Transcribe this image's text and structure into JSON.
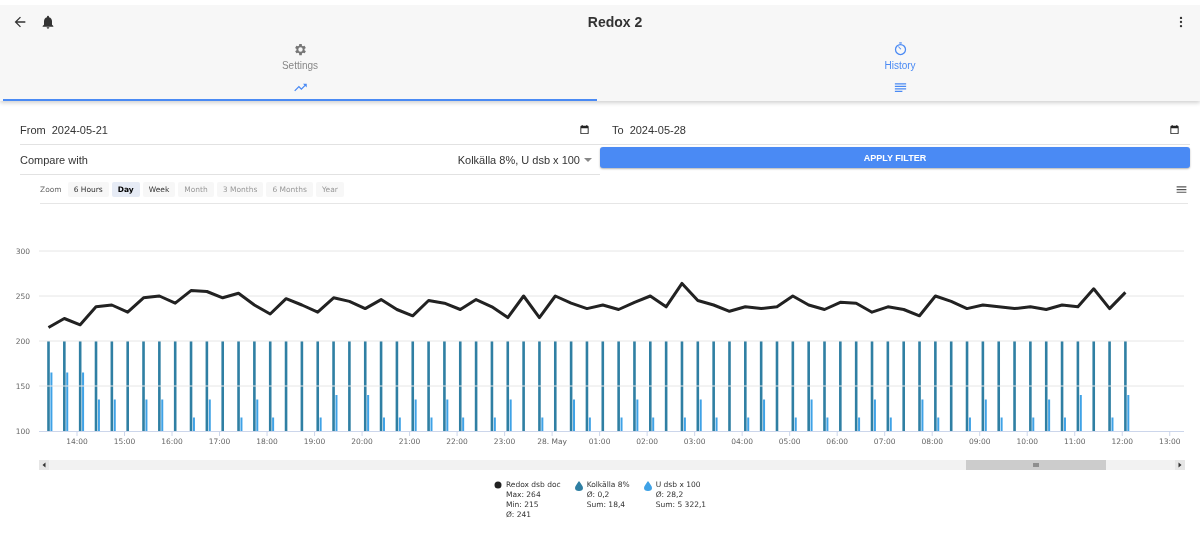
{
  "header": {
    "title": "Redox 2"
  },
  "tabs": [
    {
      "label": "Settings",
      "kind": "gear",
      "selected": false
    },
    {
      "label": "History",
      "kind": "timer",
      "selected": true
    }
  ],
  "sub_tabs": [
    {
      "kind": "chart",
      "selected": true
    },
    {
      "kind": "list",
      "selected": false
    }
  ],
  "filter": {
    "from": {
      "label": "From",
      "value": "2024-05-21"
    },
    "to": {
      "label": "To",
      "value": "2024-05-28"
    },
    "compare": {
      "label": "Compare with",
      "value": "Kolkälla 8%, U dsb x 100"
    },
    "apply_button": "APPLY FILTER"
  },
  "chart": {
    "zoom_label": "Zoom",
    "zoom_buttons": [
      {
        "label": "6 Hours",
        "selected": false,
        "disabled": false
      },
      {
        "label": "Day",
        "selected": true,
        "disabled": false
      },
      {
        "label": "Week",
        "selected": false,
        "disabled": false
      },
      {
        "label": "Month",
        "selected": false,
        "disabled": true
      },
      {
        "label": "3 Months",
        "selected": false,
        "disabled": true
      },
      {
        "label": "6 Months",
        "selected": false,
        "disabled": true
      },
      {
        "label": "Year",
        "selected": false,
        "disabled": true
      }
    ],
    "line_chart": {
      "chart_data": {
        "type": "line",
        "grid": true,
        "xlim": [
          "2024-05-27T13:12",
          "2024-05-28T13:18"
        ],
        "ylim": [
          100,
          300
        ],
        "yticks": [
          100,
          150,
          200,
          250,
          300
        ],
        "xticks": [
          {
            "value": "2024-05-27T14:00",
            "label": "14:00"
          },
          {
            "value": "2024-05-27T15:00",
            "label": "15:00"
          },
          {
            "value": "2024-05-27T16:00",
            "label": "16:00"
          },
          {
            "value": "2024-05-27T17:00",
            "label": "17:00"
          },
          {
            "value": "2024-05-27T18:00",
            "label": "18:00"
          },
          {
            "value": "2024-05-27T19:00",
            "label": "19:00"
          },
          {
            "value": "2024-05-27T20:00",
            "label": "20:00"
          },
          {
            "value": "2024-05-27T21:00",
            "label": "21:00"
          },
          {
            "value": "2024-05-27T22:00",
            "label": "22:00"
          },
          {
            "value": "2024-05-27T23:00",
            "label": "23:00"
          },
          {
            "value": "2024-05-28T00:00",
            "label": "28. May"
          },
          {
            "value": "2024-05-28T01:00",
            "label": "01:00"
          },
          {
            "value": "2024-05-28T02:00",
            "label": "02:00"
          },
          {
            "value": "2024-05-28T03:00",
            "label": "03:00"
          },
          {
            "value": "2024-05-28T04:00",
            "label": "04:00"
          },
          {
            "value": "2024-05-28T05:00",
            "label": "05:00"
          },
          {
            "value": "2024-05-28T06:00",
            "label": "06:00"
          },
          {
            "value": "2024-05-28T07:00",
            "label": "07:00"
          },
          {
            "value": "2024-05-28T08:00",
            "label": "08:00"
          },
          {
            "value": "2024-05-28T09:00",
            "label": "09:00"
          },
          {
            "value": "2024-05-28T10:00",
            "label": "10:00"
          },
          {
            "value": "2024-05-28T11:00",
            "label": "11:00"
          },
          {
            "value": "2024-05-28T12:00",
            "label": "12:00"
          },
          {
            "value": "2024-05-28T13:00",
            "label": "13:00"
          }
        ],
        "x": [
          "2024-05-27T13:24",
          "2024-05-27T13:44",
          "2024-05-27T14:04",
          "2024-05-27T14:24",
          "2024-05-27T14:44",
          "2024-05-27T15:04",
          "2024-05-27T15:24",
          "2024-05-27T15:44",
          "2024-05-27T16:04",
          "2024-05-27T16:24",
          "2024-05-27T16:44",
          "2024-05-27T17:04",
          "2024-05-27T17:24",
          "2024-05-27T17:44",
          "2024-05-27T18:04",
          "2024-05-27T18:24",
          "2024-05-27T18:44",
          "2024-05-27T19:04",
          "2024-05-27T19:24",
          "2024-05-27T19:44",
          "2024-05-27T20:04",
          "2024-05-27T20:24",
          "2024-05-27T20:44",
          "2024-05-27T21:04",
          "2024-05-27T21:24",
          "2024-05-27T21:44",
          "2024-05-27T22:04",
          "2024-05-27T22:24",
          "2024-05-27T22:44",
          "2024-05-27T23:04",
          "2024-05-27T23:24",
          "2024-05-27T23:44",
          "2024-05-28T00:04",
          "2024-05-28T00:24",
          "2024-05-28T00:44",
          "2024-05-28T01:04",
          "2024-05-28T01:24",
          "2024-05-28T01:44",
          "2024-05-28T02:04",
          "2024-05-28T02:24",
          "2024-05-28T02:44",
          "2024-05-28T03:04",
          "2024-05-28T03:24",
          "2024-05-28T03:44",
          "2024-05-28T04:04",
          "2024-05-28T04:24",
          "2024-05-28T04:44",
          "2024-05-28T05:04",
          "2024-05-28T05:24",
          "2024-05-28T05:44",
          "2024-05-28T06:04",
          "2024-05-28T06:24",
          "2024-05-28T06:44",
          "2024-05-28T07:04",
          "2024-05-28T07:24",
          "2024-05-28T07:44",
          "2024-05-28T08:04",
          "2024-05-28T08:24",
          "2024-05-28T08:44",
          "2024-05-28T09:04",
          "2024-05-28T09:24",
          "2024-05-28T09:44",
          "2024-05-28T10:04",
          "2024-05-28T10:24",
          "2024-05-28T10:44",
          "2024-05-28T11:04",
          "2024-05-28T11:24",
          "2024-05-28T11:44",
          "2024-05-28T12:04"
        ],
        "series": [
          {
            "name": "Redox dsb doc",
            "color": "#222222",
            "values": [
              215,
              225,
              218,
              238,
              240,
              232,
              248,
              250,
              242,
              256,
              255,
              248,
              253,
              240,
              230,
              247,
              240,
              232,
              248,
              244,
              236,
              246,
              235,
              228,
              245,
              242,
              235,
              246,
              238,
              226,
              250,
              226,
              250,
              242,
              236,
              240,
              235,
              243,
              250,
              238,
              264,
              245,
              240,
              233,
              238,
              236,
              238,
              250,
              240,
              235,
              243,
              242,
              232,
              238,
              235,
              228,
              250,
              244,
              236,
              240,
              238,
              236,
              238,
              235,
              240,
              238,
              258,
              236,
              254
            ]
          }
        ]
      }
    },
    "bar_chart": {
      "chart_data": {
        "type": "bar",
        "xlim": [
          "2024-05-27T13:12",
          "2024-05-28T13:18"
        ],
        "ylim": [
          100,
          300
        ],
        "x": [
          "2024-05-27T13:24",
          "2024-05-27T13:44",
          "2024-05-27T14:04",
          "2024-05-27T14:24",
          "2024-05-27T14:44",
          "2024-05-27T15:04",
          "2024-05-27T15:24",
          "2024-05-27T15:44",
          "2024-05-27T16:04",
          "2024-05-27T16:24",
          "2024-05-27T16:44",
          "2024-05-27T17:04",
          "2024-05-27T17:24",
          "2024-05-27T17:44",
          "2024-05-27T18:04",
          "2024-05-27T18:24",
          "2024-05-27T18:44",
          "2024-05-27T19:04",
          "2024-05-27T19:24",
          "2024-05-27T19:44",
          "2024-05-27T20:04",
          "2024-05-27T20:24",
          "2024-05-27T20:44",
          "2024-05-27T21:04",
          "2024-05-27T21:24",
          "2024-05-27T21:44",
          "2024-05-27T22:04",
          "2024-05-27T22:24",
          "2024-05-27T22:44",
          "2024-05-27T23:04",
          "2024-05-27T23:24",
          "2024-05-27T23:44",
          "2024-05-28T00:04",
          "2024-05-28T00:24",
          "2024-05-28T00:44",
          "2024-05-28T01:04",
          "2024-05-28T01:24",
          "2024-05-28T01:44",
          "2024-05-28T02:04",
          "2024-05-28T02:24",
          "2024-05-28T02:44",
          "2024-05-28T03:04",
          "2024-05-28T03:24",
          "2024-05-28T03:44",
          "2024-05-28T04:04",
          "2024-05-28T04:24",
          "2024-05-28T04:44",
          "2024-05-28T05:04",
          "2024-05-28T05:24",
          "2024-05-28T05:44",
          "2024-05-28T06:04",
          "2024-05-28T06:24",
          "2024-05-28T06:44",
          "2024-05-28T07:04",
          "2024-05-28T07:24",
          "2024-05-28T07:44",
          "2024-05-28T08:04",
          "2024-05-28T08:24",
          "2024-05-28T08:44",
          "2024-05-28T09:04",
          "2024-05-28T09:24",
          "2024-05-28T09:44",
          "2024-05-28T10:04",
          "2024-05-28T10:24",
          "2024-05-28T10:44",
          "2024-05-28T11:04",
          "2024-05-28T11:24",
          "2024-05-28T11:44",
          "2024-05-28T12:04"
        ],
        "series": [
          {
            "name": "Kolkälla 8%",
            "color": "#2f7fa3",
            "values": [
              200,
              200,
              200,
              200,
              200,
              200,
              200,
              200,
              200,
              200,
              200,
              200,
              200,
              200,
              200,
              200,
              200,
              200,
              200,
              200,
              200,
              200,
              200,
              200,
              200,
              200,
              200,
              200,
              200,
              200,
              200,
              200,
              200,
              200,
              200,
              200,
              200,
              200,
              200,
              200,
              200,
              200,
              200,
              200,
              200,
              200,
              200,
              200,
              200,
              200,
              200,
              200,
              200,
              200,
              200,
              200,
              200,
              200,
              200,
              200,
              200,
              200,
              200,
              200,
              200,
              200,
              200,
              200,
              200
            ]
          },
          {
            "name": "U dsb x 100",
            "color": "#3fa2e6",
            "values": [
              165,
              165,
              165,
              135,
              135,
              null,
              135,
              135,
              null,
              115,
              135,
              null,
              115,
              135,
              115,
              null,
              null,
              115,
              140,
              null,
              140,
              115,
              115,
              135,
              115,
              135,
              115,
              null,
              115,
              135,
              null,
              115,
              null,
              135,
              115,
              null,
              115,
              135,
              115,
              null,
              115,
              135,
              115,
              null,
              115,
              135,
              null,
              115,
              135,
              115,
              null,
              115,
              135,
              115,
              null,
              135,
              115,
              null,
              115,
              135,
              115,
              null,
              115,
              135,
              115,
              140,
              null,
              115,
              140
            ]
          }
        ]
      }
    },
    "legend": [
      {
        "stats": [
          "Max: 264",
          "Min: 215",
          "Ø: 241"
        ]
      },
      {
        "stats": [
          "Ø: 0,2",
          "Sum: 18,4"
        ]
      },
      {
        "stats": [
          "Ø: 28,2",
          "Sum: 5 322,1"
        ]
      }
    ]
  }
}
